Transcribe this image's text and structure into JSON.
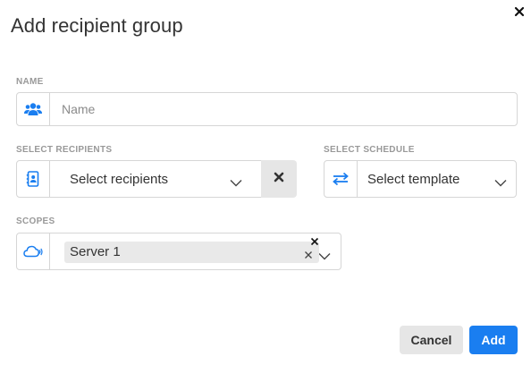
{
  "dialog": {
    "title": "Add recipient group"
  },
  "name_field": {
    "label": "NAME",
    "placeholder": "Name",
    "value": "",
    "icon": "users-icon"
  },
  "recipients_field": {
    "label": "SELECT RECIPIENTS",
    "value": "Select recipients",
    "icon": "address-book-icon"
  },
  "schedule_field": {
    "label": "SELECT SCHEDULE",
    "value": "Select template",
    "icon": "swap-arrows-icon"
  },
  "scopes_field": {
    "label": "SCOPES",
    "icon": "cloud-icon",
    "tags": [
      "Server 1"
    ]
  },
  "buttons": {
    "cancel": "Cancel",
    "add": "Add"
  },
  "colors": {
    "accent": "#1a7ef0",
    "border": "#d6d6d6",
    "label": "#999999",
    "neutral_button": "#e6e6e6"
  }
}
